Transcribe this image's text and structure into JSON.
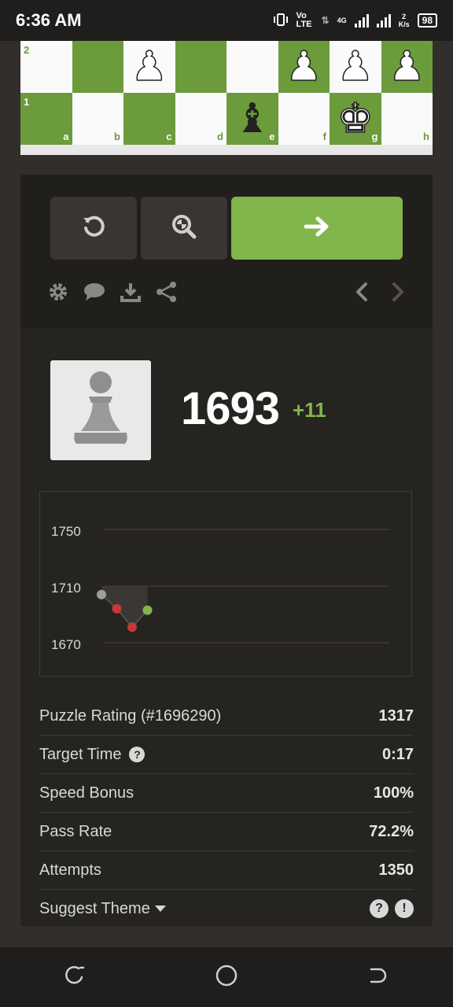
{
  "status": {
    "time": "6:36 AM",
    "network": "Vo LTE",
    "signal_label": "4G",
    "speed_value": "2",
    "speed_unit": "K/s",
    "battery": "98"
  },
  "board": {
    "ranks": [
      "2",
      "1"
    ],
    "files": [
      "a",
      "b",
      "c",
      "d",
      "e",
      "f",
      "g",
      "h"
    ]
  },
  "rating": {
    "value": "1693",
    "delta": "+11"
  },
  "graph": {
    "ticks": [
      "1750",
      "1710",
      "1670"
    ]
  },
  "chart_data": {
    "type": "line",
    "y_ticks": [
      1750,
      1710,
      1670
    ],
    "ylim": [
      1660,
      1760
    ],
    "series": [
      {
        "values": [
          1704,
          1694,
          1681,
          1693
        ]
      }
    ],
    "point_colors": [
      "#9e9e9e",
      "#c33a3a",
      "#c33a3a",
      "#81b64c"
    ]
  },
  "stats": [
    {
      "label": "Puzzle Rating (#1696290)",
      "value": "1317"
    },
    {
      "label": "Target Time",
      "value": "0:17"
    },
    {
      "label": "Speed Bonus",
      "value": "100%"
    },
    {
      "label": "Pass Rate",
      "value": "72.2%"
    },
    {
      "label": "Attempts",
      "value": "1350"
    }
  ],
  "suggest": {
    "label": "Suggest Theme",
    "help_icon": "?",
    "report_icon": "!"
  },
  "colors": {
    "accent": "#81b64c",
    "dark_square": "#6b9b3b",
    "light_square": "#fafafa"
  }
}
